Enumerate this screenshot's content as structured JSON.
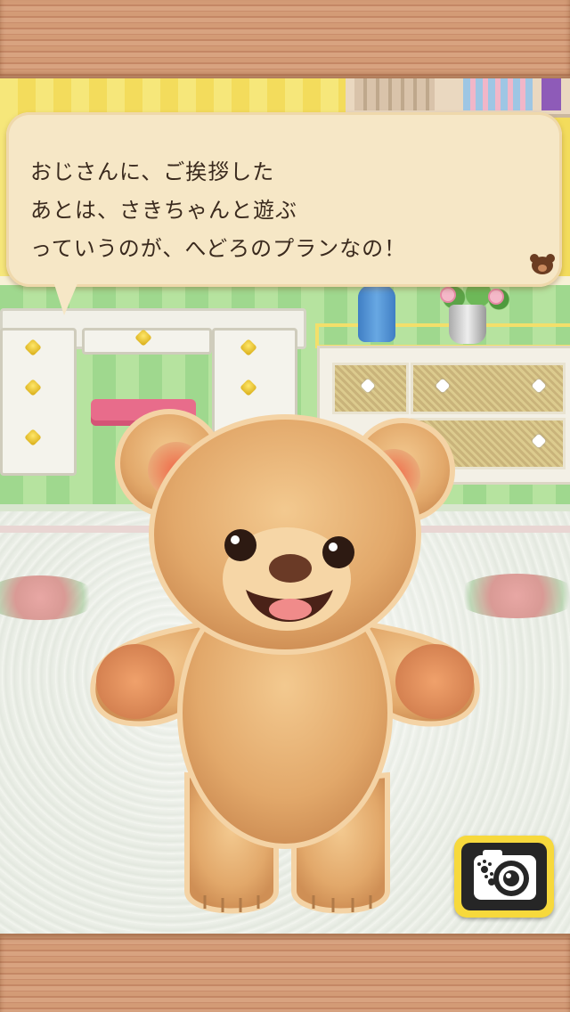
{
  "dialogue": {
    "text": "おじさんに、ご挨拶した\nあとは、さきちゃんと遊ぶ\nっていうのが、へどろのプランなの！",
    "indicator_icon": "bear-head-icon"
  },
  "camera_button": {
    "icon": "camera-icon",
    "accent": "#f7d93c"
  },
  "character": {
    "icon": "teddy-bear"
  },
  "colors": {
    "bubble": "#f6e7c6",
    "wood": "#d39b76",
    "text": "#3a2a1e"
  }
}
